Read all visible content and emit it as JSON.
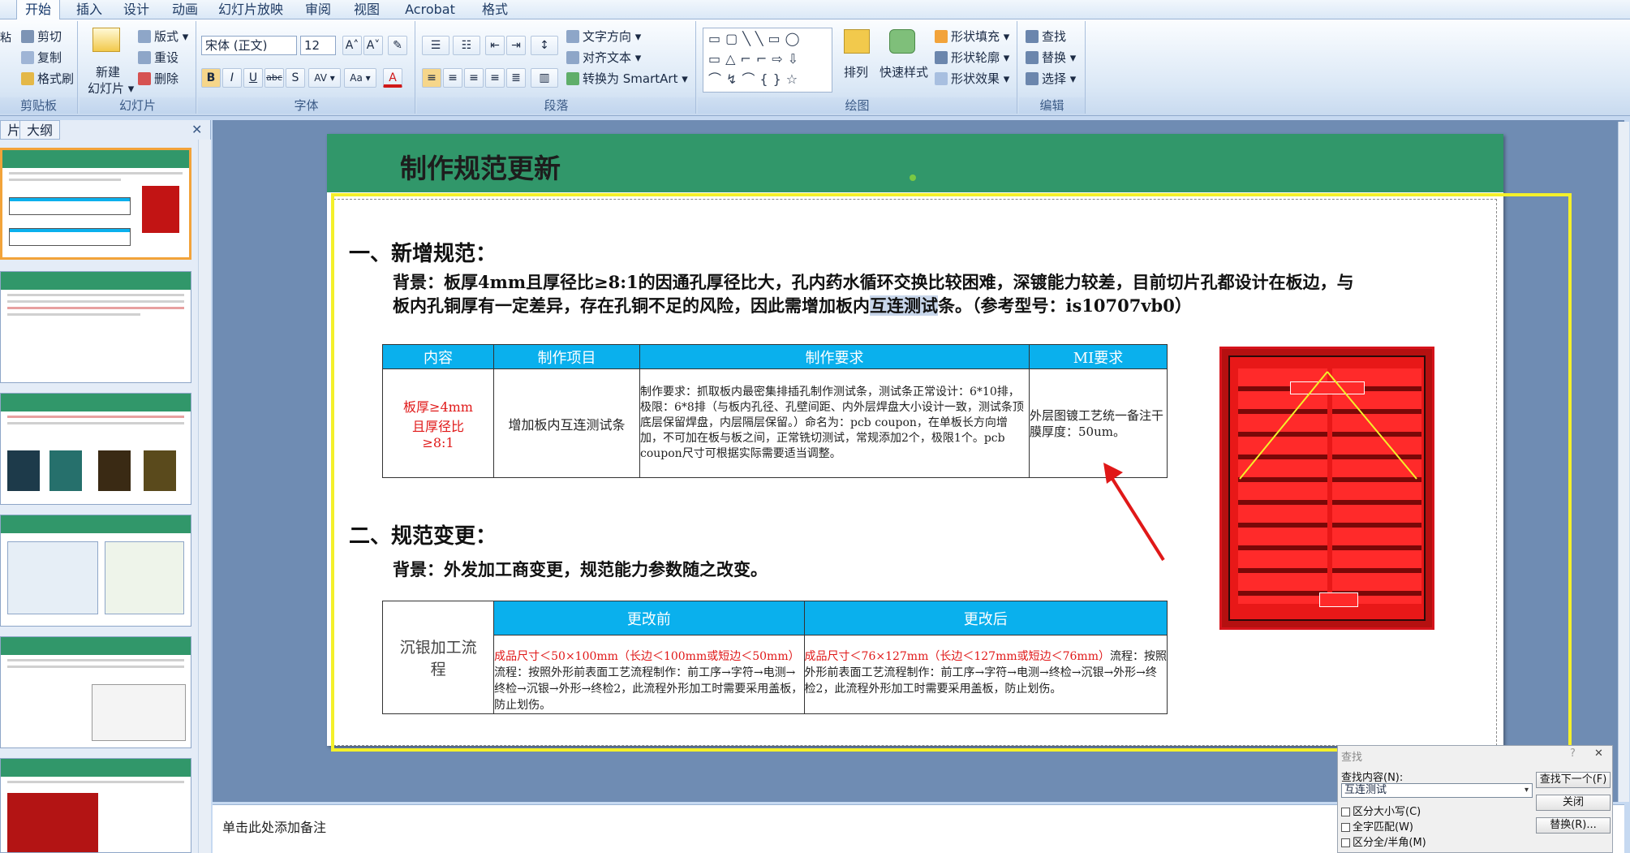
{
  "ribbon": {
    "tabs": [
      "开始",
      "插入",
      "设计",
      "动画",
      "幻灯片放映",
      "审阅",
      "视图",
      "Acrobat",
      "格式"
    ],
    "clipboard": {
      "cut": "剪切",
      "copy": "复制",
      "painter": "格式刷",
      "paste": "粘",
      "label": "剪贴板"
    },
    "slides": {
      "new1": "新建",
      "new2": "幻灯片 ▾",
      "layout": "版式 ▾",
      "reset": "重设",
      "delete": "删除",
      "label": "幻灯片"
    },
    "font": {
      "name": "宋体 (正文)",
      "size": "12",
      "bold": "B",
      "italic": "I",
      "underline": "U",
      "strike": "abc",
      "shadow": "S",
      "spacing": "AV ▾",
      "case": "Aa ▾",
      "color": "A",
      "grow": "A˄",
      "shrink": "A˅",
      "clear": "✎",
      "label": "字体"
    },
    "paragraph": {
      "textdir": "文字方向 ▾",
      "align": "对齐文本 ▾",
      "smartart": "转换为 SmartArt ▾",
      "label": "段落"
    },
    "drawing": {
      "arrange": "排列",
      "quickstyle": "快速样式",
      "fill": "形状填充 ▾",
      "outline": "形状轮廓 ▾",
      "effect": "形状效果 ▾",
      "label": "绘图"
    },
    "editing": {
      "find": "查找",
      "replace": "替换 ▾",
      "select": "选择 ▾",
      "label": "编辑"
    }
  },
  "pane": {
    "tab1": "片",
    "tab2": "大纲",
    "close": "✕"
  },
  "slide": {
    "title": "制作规范更新",
    "sec1": "一、新增规范：",
    "bg1_pre": "背景：板厚4mm且厚径比≥8:1的因通孔厚径比大，孔内药水循环交换比较困难，深镀能力较差，目前切片孔都设计在板边，与",
    "bg1_l2_pre": "板内孔铜厚有一定差异，存在孔铜不足的风险，因此需增加板内",
    "bg1_highlight": "互连测试",
    "bg1_l2_post": "条。（参考型号：is10707vb0）",
    "table1": {
      "headers": [
        "内容",
        "制作项目",
        "制作要求",
        "MI要求"
      ],
      "c1": "板厚≥4mm且厚径比≥8:1",
      "c2": "增加板内互连测试条",
      "c3": "制作要求：抓取板内最密集排插孔制作测试条，测试条正常设计：6*10排，极限：6*8排（与板内孔径、孔壁间距、内外层焊盘大小设计一致，测试条顶底层保留焊盘，内层隔层保留。）命名为：pcb coupon，在单板长方向增加，不可加在板与板之间，正常铣切测试，常规添加2个，极限1个。pcb coupon尺寸可根据实际需要适当调整。",
      "c4": "外层图镀工艺统一备注干膜厚度：50um。"
    },
    "sec2": "二、规范变更：",
    "bg2": "背景：外发加工商变更，规范能力参数随之改变。",
    "table2": {
      "h1": "更改前",
      "h2": "更改后",
      "left": "沉银加工流程",
      "before_red": "成品尺寸＜50×100mm（长边＜100mm或短边＜50mm）",
      "before": "流程：按照外形前表面工艺流程制作：前工序→字符→电测→终检→沉银→外形→终检2，此流程外形加工时需要采用盖板，防止划伤。",
      "after_red": "成品尺寸＜76×127mm（长边＜127mm或短边＜76mm）",
      "after": "流程：按照外形前表面工艺流程制作：前工序→字符→电测→终检→沉银→外形→终检2，此流程外形加工时需要采用盖板，防止划伤。"
    }
  },
  "notes": "单击此处添加备注",
  "find": {
    "title": "查找",
    "label": "查找内容(N):",
    "value": "互连测试",
    "next": "查找下一个(F)",
    "close": "关闭",
    "replace": "替换(R)...",
    "case": "区分大小写(C)",
    "whole": "全字匹配(W)",
    "width": "区分全/半角(M)",
    "help": "?",
    "x": "✕"
  },
  "colors": {
    "accent": "#31976a",
    "header": "#0ab0ed",
    "highlight": "#f4f02a",
    "red": "#e01818"
  }
}
